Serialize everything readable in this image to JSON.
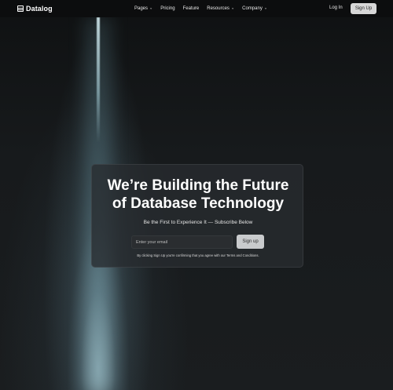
{
  "nav": {
    "brand": "Datalog",
    "items": [
      {
        "label": "Pages",
        "dropdown": true
      },
      {
        "label": "Pricing",
        "dropdown": false
      },
      {
        "label": "Feature",
        "dropdown": false
      },
      {
        "label": "Resources",
        "dropdown": true
      },
      {
        "label": "Company",
        "dropdown": true
      }
    ],
    "login": "Log In",
    "signup": "Sign Up"
  },
  "hero": {
    "headline_line1": "We’re Building the Future",
    "headline_line2": "of Database Technology",
    "subtitle": "Be the First to Experience It — Subscribe Below",
    "email_placeholder": "Enter your email",
    "cta": "Sign up",
    "terms": "By clicking Sign Up you're confirming that you agree with our Terms and Conditions."
  },
  "colors": {
    "background": "#141618",
    "nav_bg": "#0c0d0e",
    "card_bg": "#282c2f",
    "button_bg": "#d7d7d7"
  }
}
